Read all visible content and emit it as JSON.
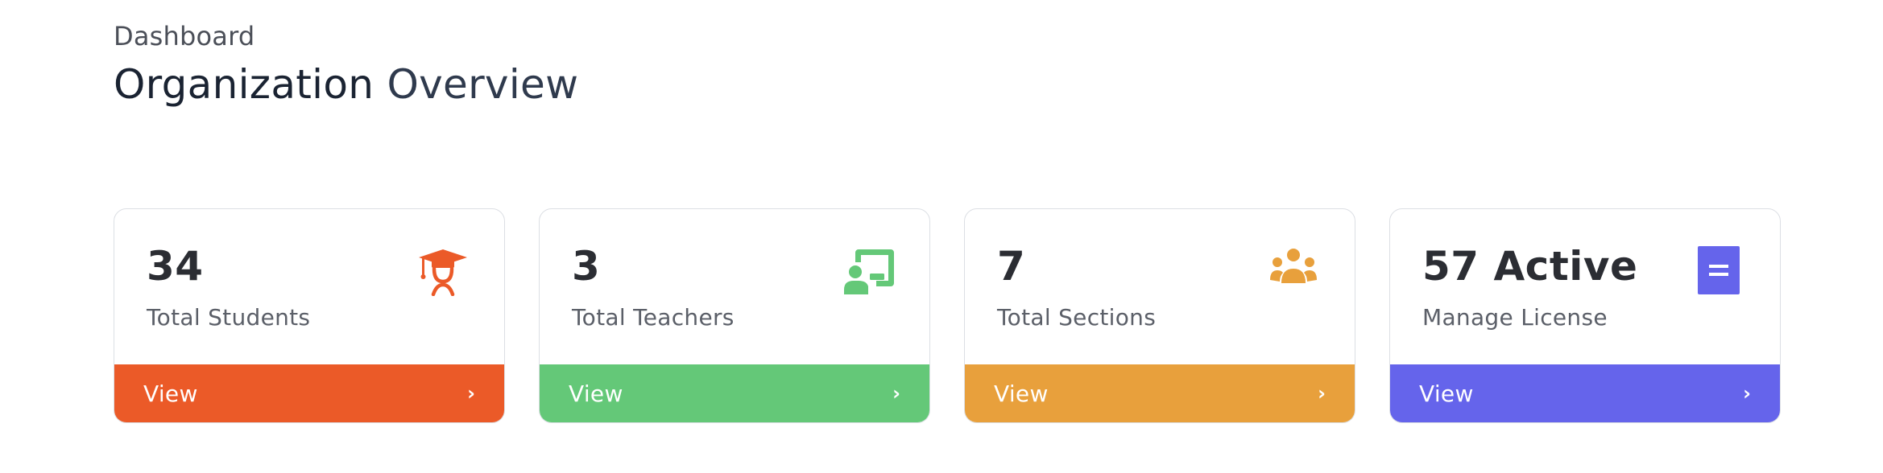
{
  "header": {
    "breadcrumb": "Dashboard",
    "title_part1": "Organization",
    "title_part2": "Overview"
  },
  "cards": [
    {
      "value": "34",
      "label": "Total Students",
      "icon": "graduate-icon",
      "color": "#EB5A28",
      "footer_label": "View",
      "chevron": "›"
    },
    {
      "value": "3",
      "label": "Total Teachers",
      "icon": "teacher-board-icon",
      "color": "#64C878",
      "footer_label": "View",
      "chevron": "›"
    },
    {
      "value": "7",
      "label": "Total Sections",
      "icon": "group-icon",
      "color": "#E8A03C",
      "footer_label": "View",
      "chevron": "›"
    },
    {
      "value": "57 Active",
      "label": "Manage License",
      "icon": "license-document-icon",
      "color": "#6564EB",
      "footer_label": "View",
      "chevron": "›"
    }
  ]
}
